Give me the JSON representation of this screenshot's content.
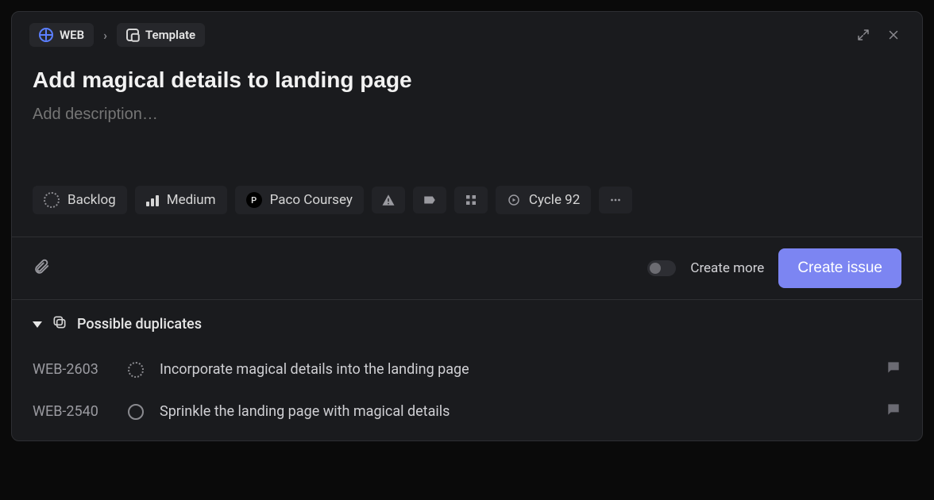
{
  "breadcrumb": {
    "project_code": "WEB",
    "template_label": "Template"
  },
  "issue": {
    "title": "Add magical details to landing page",
    "description_placeholder": "Add description…"
  },
  "pills": {
    "status": "Backlog",
    "priority": "Medium",
    "assignee": {
      "name": "Paco Coursey",
      "initial": "P"
    },
    "cycle": "Cycle 92"
  },
  "footer": {
    "create_more_label": "Create more",
    "submit_label": "Create issue"
  },
  "duplicates": {
    "heading": "Possible duplicates",
    "items": [
      {
        "key": "WEB-2603",
        "status": "backlog",
        "title": "Incorporate magical details into the landing page"
      },
      {
        "key": "WEB-2540",
        "status": "todo",
        "title": "Sprinkle the landing page with magical details"
      }
    ]
  }
}
